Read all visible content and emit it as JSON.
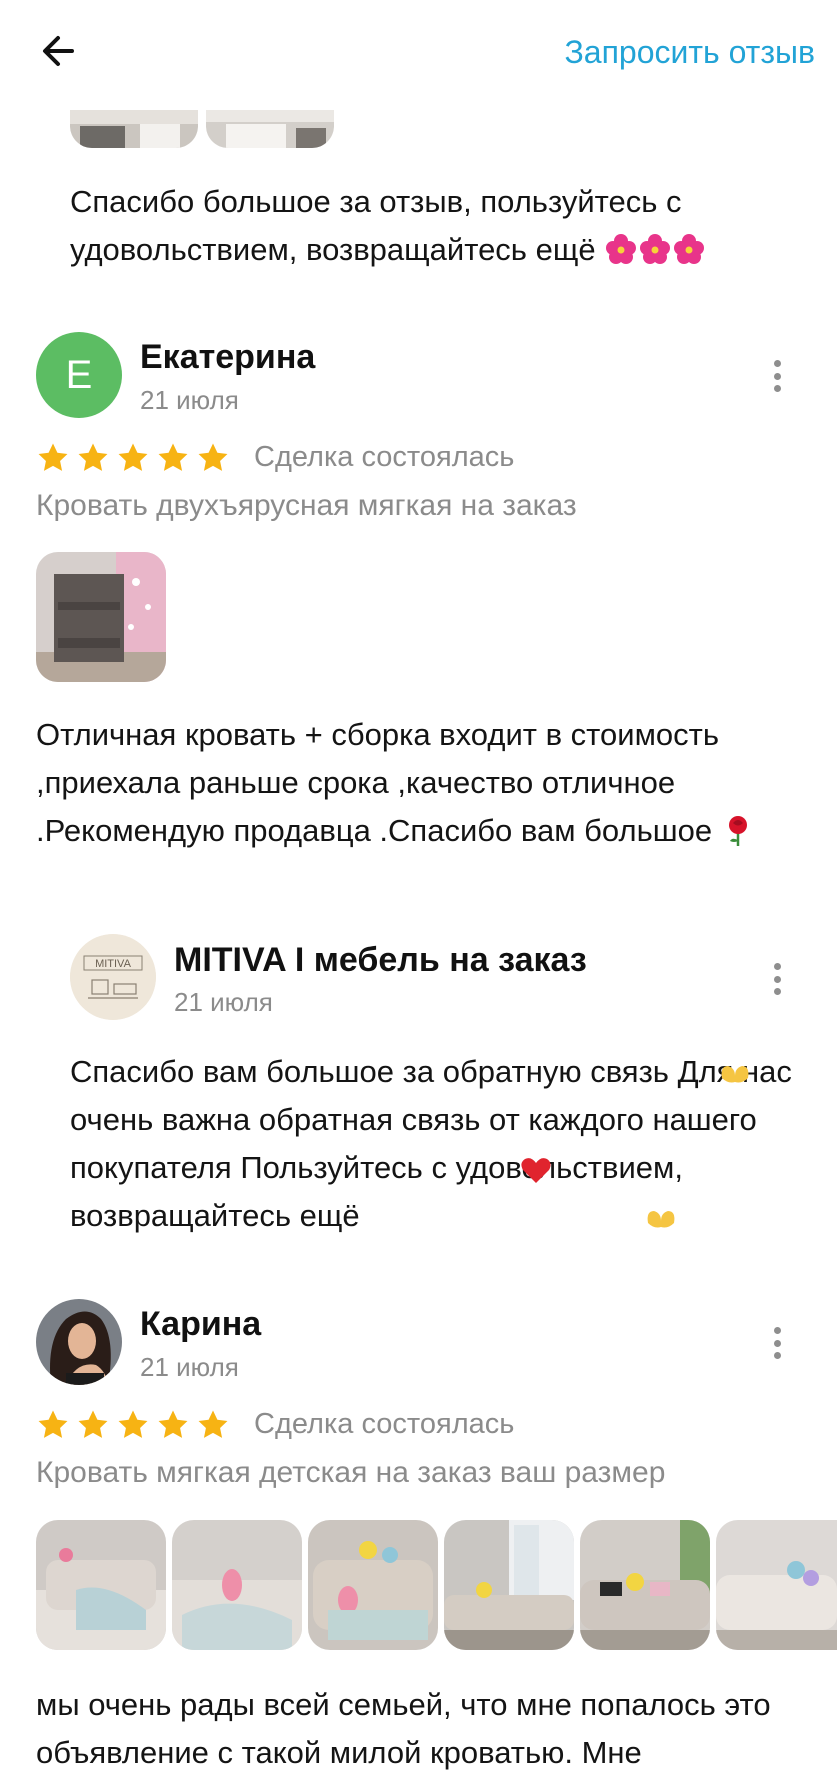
{
  "header": {
    "request_review_label": "Запросить отзыв"
  },
  "top_reply": {
    "text": "Спасибо большое за отзыв, пользуйтесь с удовольствием, возвращайтесь ещё"
  },
  "reviews": [
    {
      "avatar_letter": "Е",
      "avatar_color": "#5cbd63",
      "name": "Екатерина",
      "date": "21 июля",
      "rating": 5,
      "status": "Сделка состоялась",
      "product": "Кровать двухъярусная мягкая на заказ",
      "text": "Отличная кровать + сборка входит в стоимость ,приехала раньше срока ,качество отличное .Рекомендую продавца .Спасибо вам большое",
      "reply": {
        "seller_name": "MITIVA  I  мебель на заказ",
        "logo_text": "MITIVA",
        "date": "21 июля",
        "text": "Спасибо вам большое за обратную связь Для нас очень важна обратная связь от каждого нашего покупателя Пользуйтесь с удовольствием, возвращайтесь ещё"
      }
    },
    {
      "name": "Карина",
      "date": "21 июля",
      "rating": 5,
      "status": "Сделка состоялась",
      "product": "Кровать мягкая детская на заказ ваш размер",
      "text": "мы очень рады всей семьей, что мне попалось это объявление с такой милой кроватью. Мне"
    }
  ],
  "colors": {
    "accent_link": "#22a3d6",
    "star": "#f7b313",
    "muted_text": "#8b8b8b"
  },
  "icons": {
    "back": "arrow-left-icon",
    "menu": "more-vertical-icon",
    "star": "star-icon"
  }
}
